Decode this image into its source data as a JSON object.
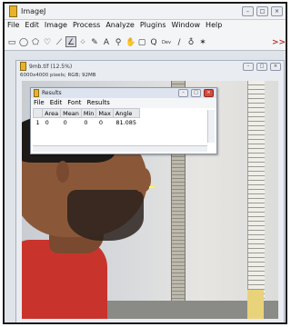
{
  "main": {
    "title": "ImageJ",
    "menu": [
      "File",
      "Edit",
      "Image",
      "Process",
      "Analyze",
      "Plugins",
      "Window",
      "Help"
    ],
    "tools": [
      {
        "name": "rectangle-tool-icon",
        "glyph": "▭"
      },
      {
        "name": "oval-tool-icon",
        "glyph": "◯"
      },
      {
        "name": "polygon-tool-icon",
        "glyph": "⬠"
      },
      {
        "name": "freehand-tool-icon",
        "glyph": "♡"
      },
      {
        "name": "line-tool-icon",
        "glyph": "⟋"
      },
      {
        "name": "angle-tool-icon",
        "glyph": "∠",
        "active": true
      },
      {
        "name": "point-tool-icon",
        "glyph": "⁘"
      },
      {
        "name": "wand-tool-icon",
        "glyph": "✎"
      },
      {
        "name": "text-tool-icon",
        "glyph": "A"
      },
      {
        "name": "magnifier-tool-icon",
        "glyph": "⚲"
      },
      {
        "name": "hand-tool-icon",
        "glyph": "✋"
      },
      {
        "name": "color-picker-icon",
        "glyph": "▢"
      },
      {
        "name": "zoom-icon",
        "glyph": "Q"
      },
      {
        "name": "developer-menu-icon",
        "glyph": "Dev"
      },
      {
        "name": "pen-icon",
        "glyph": "∕"
      },
      {
        "name": "dropper-icon",
        "glyph": "♁"
      },
      {
        "name": "spray-icon",
        "glyph": "✶"
      }
    ],
    "more_tools": ">>"
  },
  "image_window": {
    "title": "9mb.tif (12.5%)",
    "info": "6000x4000 pixels; RGB; 92MB"
  },
  "results": {
    "title": "Results",
    "menu": [
      "File",
      "Edit",
      "Font",
      "Results"
    ],
    "columns": [
      "",
      "Area",
      "Mean",
      "Min",
      "Max",
      "Angle"
    ],
    "rows": [
      [
        "1",
        "0",
        "0",
        "0",
        "0",
        "81.085"
      ]
    ]
  }
}
